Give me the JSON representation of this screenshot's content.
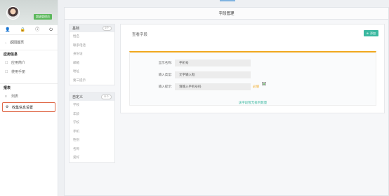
{
  "sidebar": {
    "badge": "超级管理员",
    "icons": [
      {
        "name": "user-icon",
        "glyph": "👤"
      },
      {
        "name": "lock-icon",
        "glyph": "🔒"
      },
      {
        "name": "info-icon",
        "glyph": "ⓘ"
      },
      {
        "name": "logout-icon",
        "glyph": "⏻"
      }
    ],
    "back_label": "返回首页",
    "app_section": "应用信息",
    "app_items": [
      {
        "icon": "☐",
        "label": "应用简介"
      },
      {
        "icon": "☐",
        "label": "使用手册"
      }
    ],
    "report_section": "报表",
    "report_items": [
      {
        "icon": "≡",
        "label": "列表"
      },
      {
        "icon": "⚙",
        "label": "收集信息设置"
      }
    ]
  },
  "panel": {
    "title": "字段管理"
  },
  "basic_group": {
    "title": "基础",
    "count": "6个",
    "items": [
      "姓名",
      "联系电话",
      "身份证",
      "邮箱",
      "地址",
      "要三提示"
    ]
  },
  "custom_group": {
    "title": "自定义",
    "count": "11个",
    "items": [
      "学校",
      "年龄",
      "学校",
      "手机",
      "性别",
      "名称",
      "爱好"
    ]
  },
  "detail": {
    "title": "查看字段",
    "add_label": "添加",
    "rows": [
      {
        "label": "显示名称:",
        "value": "手机号"
      },
      {
        "label": "输入类型:",
        "value": "文字输入框"
      },
      {
        "label": "输入提示:",
        "value": "请输入手机号码",
        "hint": "必填"
      }
    ],
    "footer_link": "该字段暂无排列数量"
  }
}
